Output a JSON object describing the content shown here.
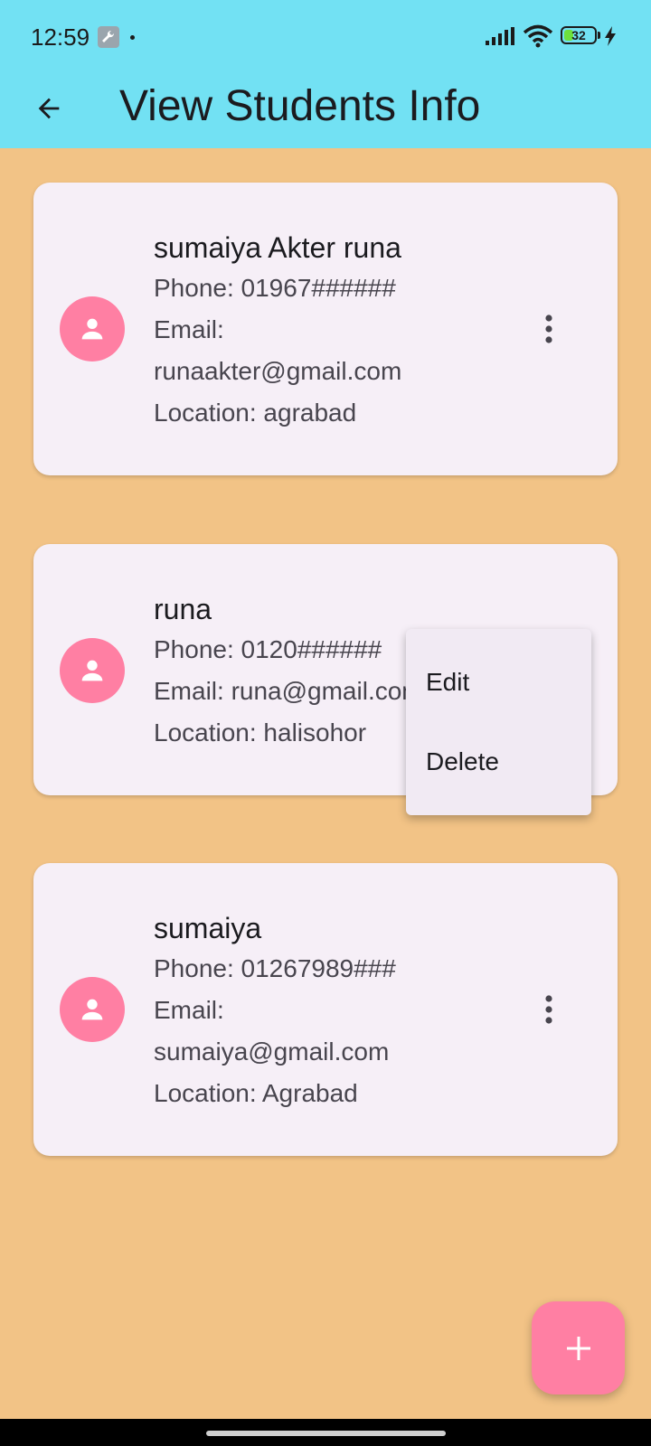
{
  "status_bar": {
    "time": "12:59",
    "battery_level": "32",
    "icons": [
      "wrench-icon",
      "dot-icon",
      "signal-icon",
      "wifi-icon",
      "battery-icon",
      "bolt-icon"
    ]
  },
  "app_bar": {
    "title": "View Students Info",
    "back_icon": "arrow-back-icon",
    "background": "#72E1F3"
  },
  "students": [
    {
      "name": "sumaiya Akter runa",
      "phone": "Phone: 01967######",
      "email_label": "Email:",
      "email_value": "runaakter@gmail.com",
      "location": "Location: agrabad"
    },
    {
      "name": "runa",
      "phone": "Phone: 0120######",
      "email": "Email: runa@gmail.com",
      "location": "Location: halisohor"
    },
    {
      "name": "sumaiya",
      "phone": "Phone: 01267989###",
      "email_label": "Email:",
      "email_value": "sumaiya@gmail.com",
      "location": "Location: Agrabad"
    }
  ],
  "popup_menu": {
    "edit_label": "Edit",
    "delete_label": "Delete"
  },
  "fab": {
    "icon": "plus-icon",
    "color": "#FF7FA3"
  },
  "colors": {
    "page_background": "#F2C386",
    "card_background": "#F6EFF7",
    "avatar": "#FF7FA3"
  }
}
